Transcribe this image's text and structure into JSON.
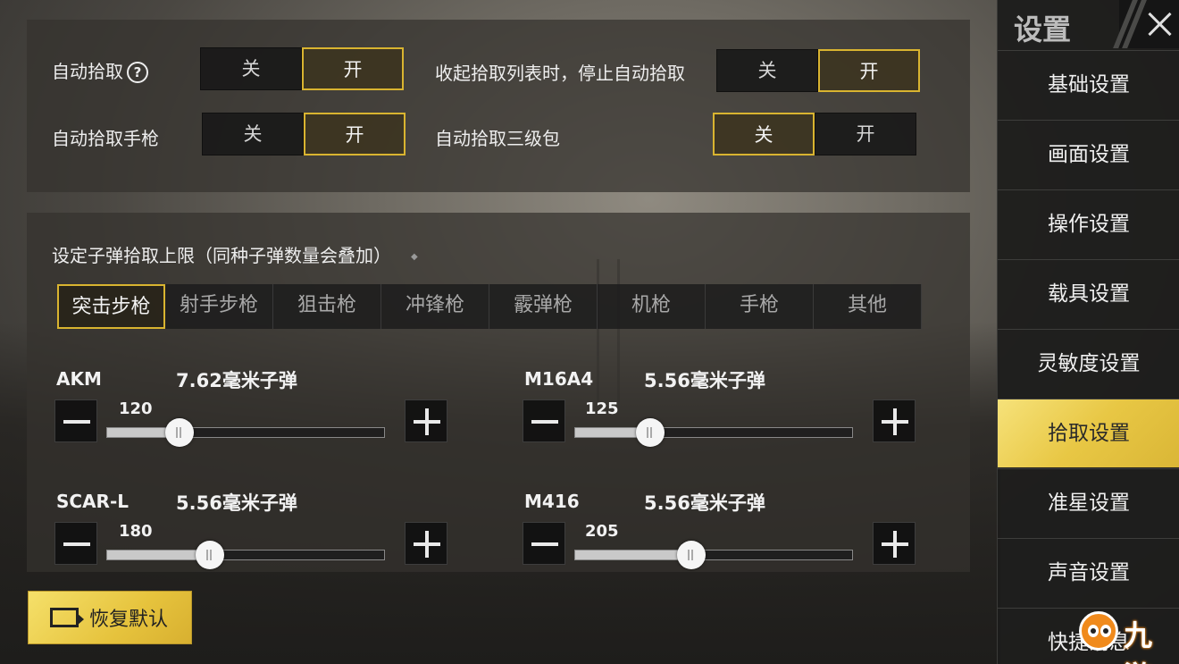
{
  "pickup": {
    "auto_pickup_label": "自动拾取",
    "auto_pickup_help": "?",
    "auto_pickup_pistol_label": "自动拾取手枪",
    "stop_on_collapse_label": "收起拾取列表时，停止自动拾取",
    "auto_pickup_lv3_bag_label": "自动拾取三级包",
    "off": "关",
    "on": "开",
    "states": {
      "auto_pickup": "on",
      "auto_pickup_pistol": "on",
      "stop_on_collapse": "on",
      "auto_pickup_lv3_bag": "off"
    }
  },
  "ammo": {
    "title": "设定子弹拾取上限（同种子弹数量会叠加）",
    "tabs": [
      "突击步枪",
      "射手步枪",
      "狙击枪",
      "冲锋枪",
      "霰弹枪",
      "机枪",
      "手枪",
      "其他"
    ],
    "active_tab": 0,
    "guns": [
      {
        "name": "AKM",
        "ammo": "7.62毫米子弹",
        "value": "120",
        "level": 0.26
      },
      {
        "name": "M16A4",
        "ammo": "5.56毫米子弹",
        "value": "125",
        "level": 0.27
      },
      {
        "name": "SCAR-L",
        "ammo": "5.56毫米子弹",
        "value": "180",
        "level": 0.37
      },
      {
        "name": "M416",
        "ammo": "5.56毫米子弹",
        "value": "205",
        "level": 0.42
      }
    ]
  },
  "reset_label": "恢复默认",
  "sidebar": {
    "title": "设置",
    "items": [
      "基础设置",
      "画面设置",
      "操作设置",
      "载具设置",
      "灵敏度设置",
      "拾取设置",
      "准星设置",
      "声音设置",
      "快捷消息"
    ],
    "active": 5
  },
  "watermark": "九游",
  "colors": {
    "accent_gold": "#d9b430",
    "active_tab_gold": "#e8c744"
  }
}
